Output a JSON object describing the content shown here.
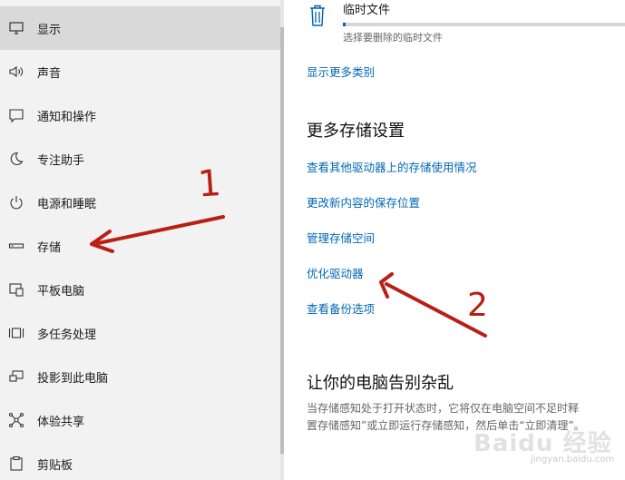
{
  "sidebar": {
    "items": [
      {
        "label": "显示",
        "icon": "display-icon"
      },
      {
        "label": "声音",
        "icon": "sound-icon"
      },
      {
        "label": "通知和操作",
        "icon": "notification-icon"
      },
      {
        "label": "专注助手",
        "icon": "moon-icon"
      },
      {
        "label": "电源和睡眠",
        "icon": "power-icon"
      },
      {
        "label": "存储",
        "icon": "storage-icon"
      },
      {
        "label": "平板电脑",
        "icon": "tablet-icon"
      },
      {
        "label": "多任务处理",
        "icon": "multitask-icon"
      },
      {
        "label": "投影到此电脑",
        "icon": "project-icon"
      },
      {
        "label": "体验共享",
        "icon": "share-icon"
      },
      {
        "label": "剪贴板",
        "icon": "clipboard-icon"
      }
    ],
    "selected": "显示"
  },
  "temp_files": {
    "title": "临时文件",
    "subtitle": "选择要删除的临时文件",
    "progress": 0.01
  },
  "links": {
    "show_more": "显示更多类别",
    "other_drives": "查看其他驱动器上的存储使用情况",
    "save_location": "更改新内容的保存位置",
    "manage_spaces": "管理存储空间",
    "optimize": "优化驱动器",
    "backup": "查看备份选项"
  },
  "sections": {
    "more_settings": "更多存储设置",
    "declutter": "让你的电脑告别杂乱",
    "declutter_desc_1": "当存储感知处于打开状态时，它将仅在电脑空间不足时释",
    "declutter_desc_2": "置存储感知”或立即运行存储感知，然后单击“立即清理”。"
  },
  "annotations": {
    "mark_1": "1",
    "mark_2": "2",
    "color": "#b81f15"
  },
  "watermark": {
    "text": "Baidu 经验",
    "sub": "jingyan.baidu.com"
  },
  "colors": {
    "accent": "#0067b8",
    "sidebar_bg": "#f2f2f2",
    "selected_bg": "#d9d9d9"
  }
}
